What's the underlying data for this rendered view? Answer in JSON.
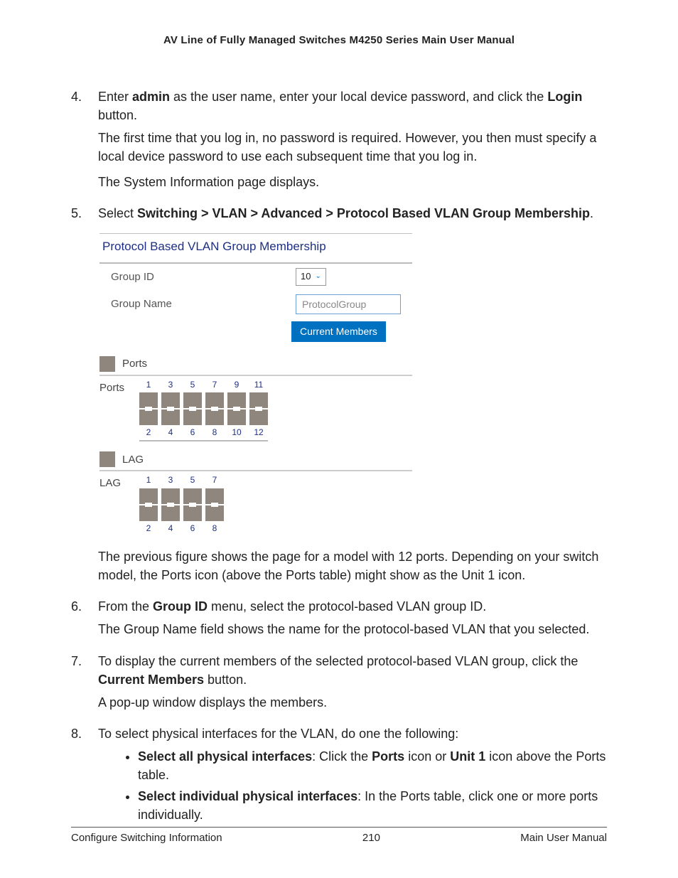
{
  "header": {
    "title": "AV Line of Fully Managed Switches M4250 Series Main User Manual"
  },
  "steps": {
    "s4": {
      "p1a": "Enter ",
      "p1b": "admin",
      "p1c": " as the user name, enter your local device password, and click the ",
      "p1d": "Login",
      "p1e": " button.",
      "p2": "The first time that you log in, no password is required. However, you then must specify a local device password to use each subsequent time that you log in.",
      "p3": "The System Information page displays."
    },
    "s5": {
      "p1a": "Select ",
      "p1b": "Switching > VLAN > Advanced > Protocol Based VLAN Group Membership",
      "p1c": ".",
      "p2": "The previous figure shows the page for a model with 12 ports. Depending on your switch model, the Ports icon (above the Ports table) might show as the Unit 1 icon."
    },
    "s6": {
      "p1a": "From the ",
      "p1b": "Group ID",
      "p1c": " menu, select the protocol-based VLAN group ID.",
      "p2": "The Group Name field shows the name for the protocol-based VLAN that you selected."
    },
    "s7": {
      "p1a": "To display the current members of the selected protocol-based VLAN group, click the ",
      "p1b": "Current Members",
      "p1c": " button.",
      "p2": "A pop-up window displays the members."
    },
    "s8": {
      "p1": "To select physical interfaces for the VLAN, do one the following:",
      "b1a": "Select all physical interfaces",
      "b1b": ": Click the ",
      "b1c": "Ports",
      "b1d": " icon or ",
      "b1e": "Unit 1",
      "b1f": " icon above the Ports table.",
      "b2a": "Select individual physical interfaces",
      "b2b": ": In the Ports table, click one or more ports individually."
    }
  },
  "figure": {
    "title": "Protocol Based VLAN Group Membership",
    "groupIdLabel": "Group ID",
    "groupIdValue": "10",
    "groupNameLabel": "Group Name",
    "groupNamePlaceholder": "ProtocolGroup",
    "currentMembers": "Current Members",
    "portsHead": "Ports",
    "portsLabel": "Ports",
    "lagHead": "LAG",
    "lagLabel": "LAG",
    "portsTop": [
      "1",
      "3",
      "5",
      "7",
      "9",
      "11"
    ],
    "portsBottom": [
      "2",
      "4",
      "6",
      "8",
      "10",
      "12"
    ],
    "lagTop": [
      "1",
      "3",
      "5",
      "7"
    ],
    "lagBottom": [
      "2",
      "4",
      "6",
      "8"
    ]
  },
  "footer": {
    "left": "Configure Switching Information",
    "center": "210",
    "right": "Main User Manual"
  }
}
